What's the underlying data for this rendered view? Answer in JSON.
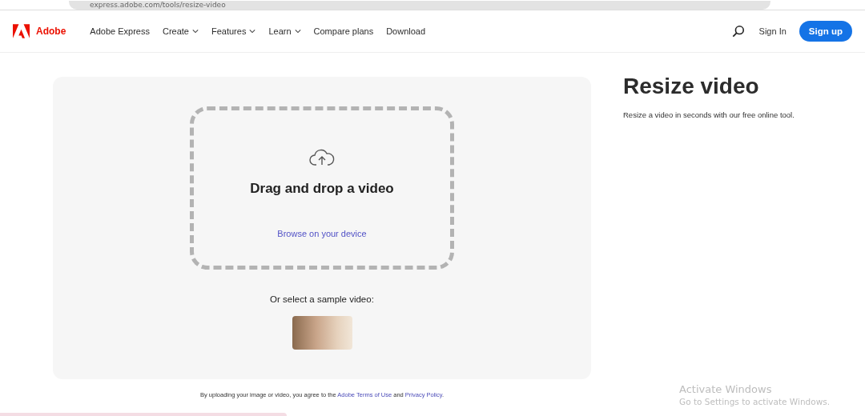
{
  "browser": {
    "url": "express.adobe.com/tools/resize-video"
  },
  "nav": {
    "brand": "Adobe",
    "items": [
      {
        "label": "Adobe Express",
        "kind": "link"
      },
      {
        "label": "Create",
        "kind": "dropdown"
      },
      {
        "label": "Features",
        "kind": "dropdown"
      },
      {
        "label": "Learn",
        "kind": "dropdown"
      },
      {
        "label": "Compare plans",
        "kind": "link"
      },
      {
        "label": "Download",
        "kind": "link"
      }
    ],
    "sign_in": "Sign In",
    "sign_up": "Sign up"
  },
  "upload": {
    "title": "Drag and drop a video",
    "browse": "Browse on your device",
    "sample_label": "Or select a sample video:"
  },
  "terms": {
    "before": "By uploading your image or video, you agree to the",
    "link1": "Adobe Terms of Use",
    "middle": "and",
    "link2": "Privacy Policy",
    "end": "."
  },
  "side": {
    "title": "Resize video",
    "subtitle": "Resize a video in seconds with our free online tool."
  },
  "os_notice": {
    "title": "Activate Windows",
    "text": "Go to Settings to activate Windows."
  }
}
